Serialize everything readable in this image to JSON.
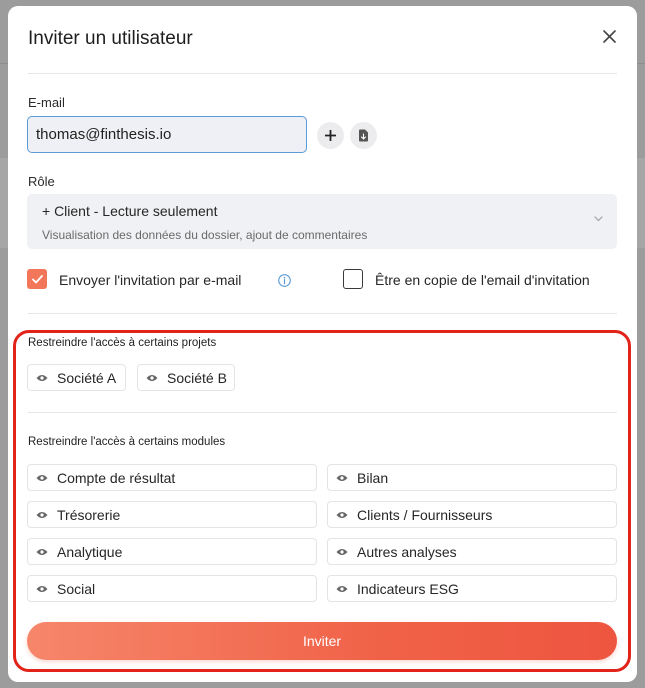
{
  "modal": {
    "title": "Inviter un utilisateur"
  },
  "email": {
    "label": "E-mail",
    "value": "thomas@finthesis.io"
  },
  "role": {
    "label": "Rôle",
    "selected": "+ Client - Lecture seulement",
    "description": "Visualisation des données du dossier, ajout de commentaires"
  },
  "options": {
    "send_invitation": {
      "label": "Envoyer l'invitation par e-mail",
      "checked": true
    },
    "cc_invitation": {
      "label": "Être en copie de l'email d'invitation",
      "checked": false
    }
  },
  "projects": {
    "title": "Restreindre l'accès à certains projets",
    "items": [
      "Société A",
      "Société B"
    ]
  },
  "modules": {
    "title": "Restreindre l'accès à certains modules",
    "items": [
      "Compte de résultat",
      "Bilan",
      "Trésorerie",
      "Clients / Fournisseurs",
      "Analytique",
      "Autres analyses",
      "Social",
      "Indicateurs ESG"
    ]
  },
  "submit_label": "Inviter",
  "colors": {
    "accent": "#F06248",
    "highlight_border": "#E2231A",
    "input_focus": "#5B9BD5"
  }
}
